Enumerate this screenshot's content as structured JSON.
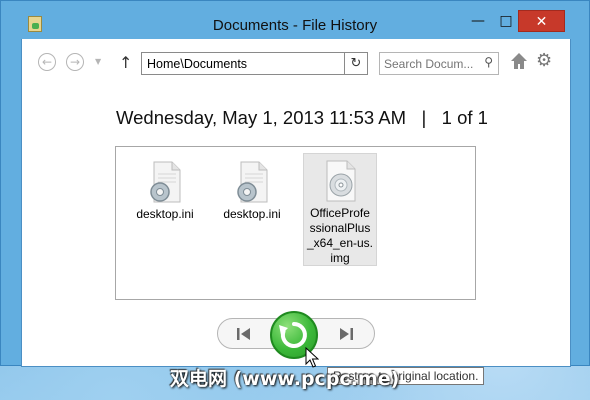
{
  "window": {
    "title": "Documents - File History",
    "minimize_glyph": "—",
    "maximize_glyph": "□",
    "close_glyph": "✕"
  },
  "toolbar": {
    "back_icon": "back-arrow-icon",
    "forward_icon": "forward-arrow-icon",
    "up_icon": "up-arrow-icon",
    "address": "Home\\Documents",
    "search_placeholder": "Search Docum...",
    "refresh_icon": "refresh-icon",
    "home_icon": "home-icon",
    "settings_icon": "gear-icon"
  },
  "snapshot": {
    "date": "Wednesday, May 1, 2013 11:53 AM",
    "separator": "|",
    "position": "1 of 1"
  },
  "files": [
    {
      "name": "desktop.ini",
      "icon": "settings-file-icon",
      "selected": false
    },
    {
      "name": "desktop.ini",
      "icon": "settings-file-icon",
      "selected": false
    },
    {
      "name": "OfficeProfessionalPlus_x64_en-us.img",
      "name_lines": [
        "OfficeProfe",
        "ssionalPlus",
        "_x64_en-us.",
        "img"
      ],
      "icon": "disc-image-icon",
      "selected": true
    }
  ],
  "controls": {
    "previous_icon": "previous-version-icon",
    "restore_icon": "restore-icon",
    "next_icon": "next-version-icon",
    "tooltip": "Restore to original location."
  },
  "watermark": "双电网 (www.pcpc.me)",
  "colors": {
    "window_frame": "#62aee0",
    "close_button": "#c7392a",
    "restore_green": "#3cb93a"
  }
}
